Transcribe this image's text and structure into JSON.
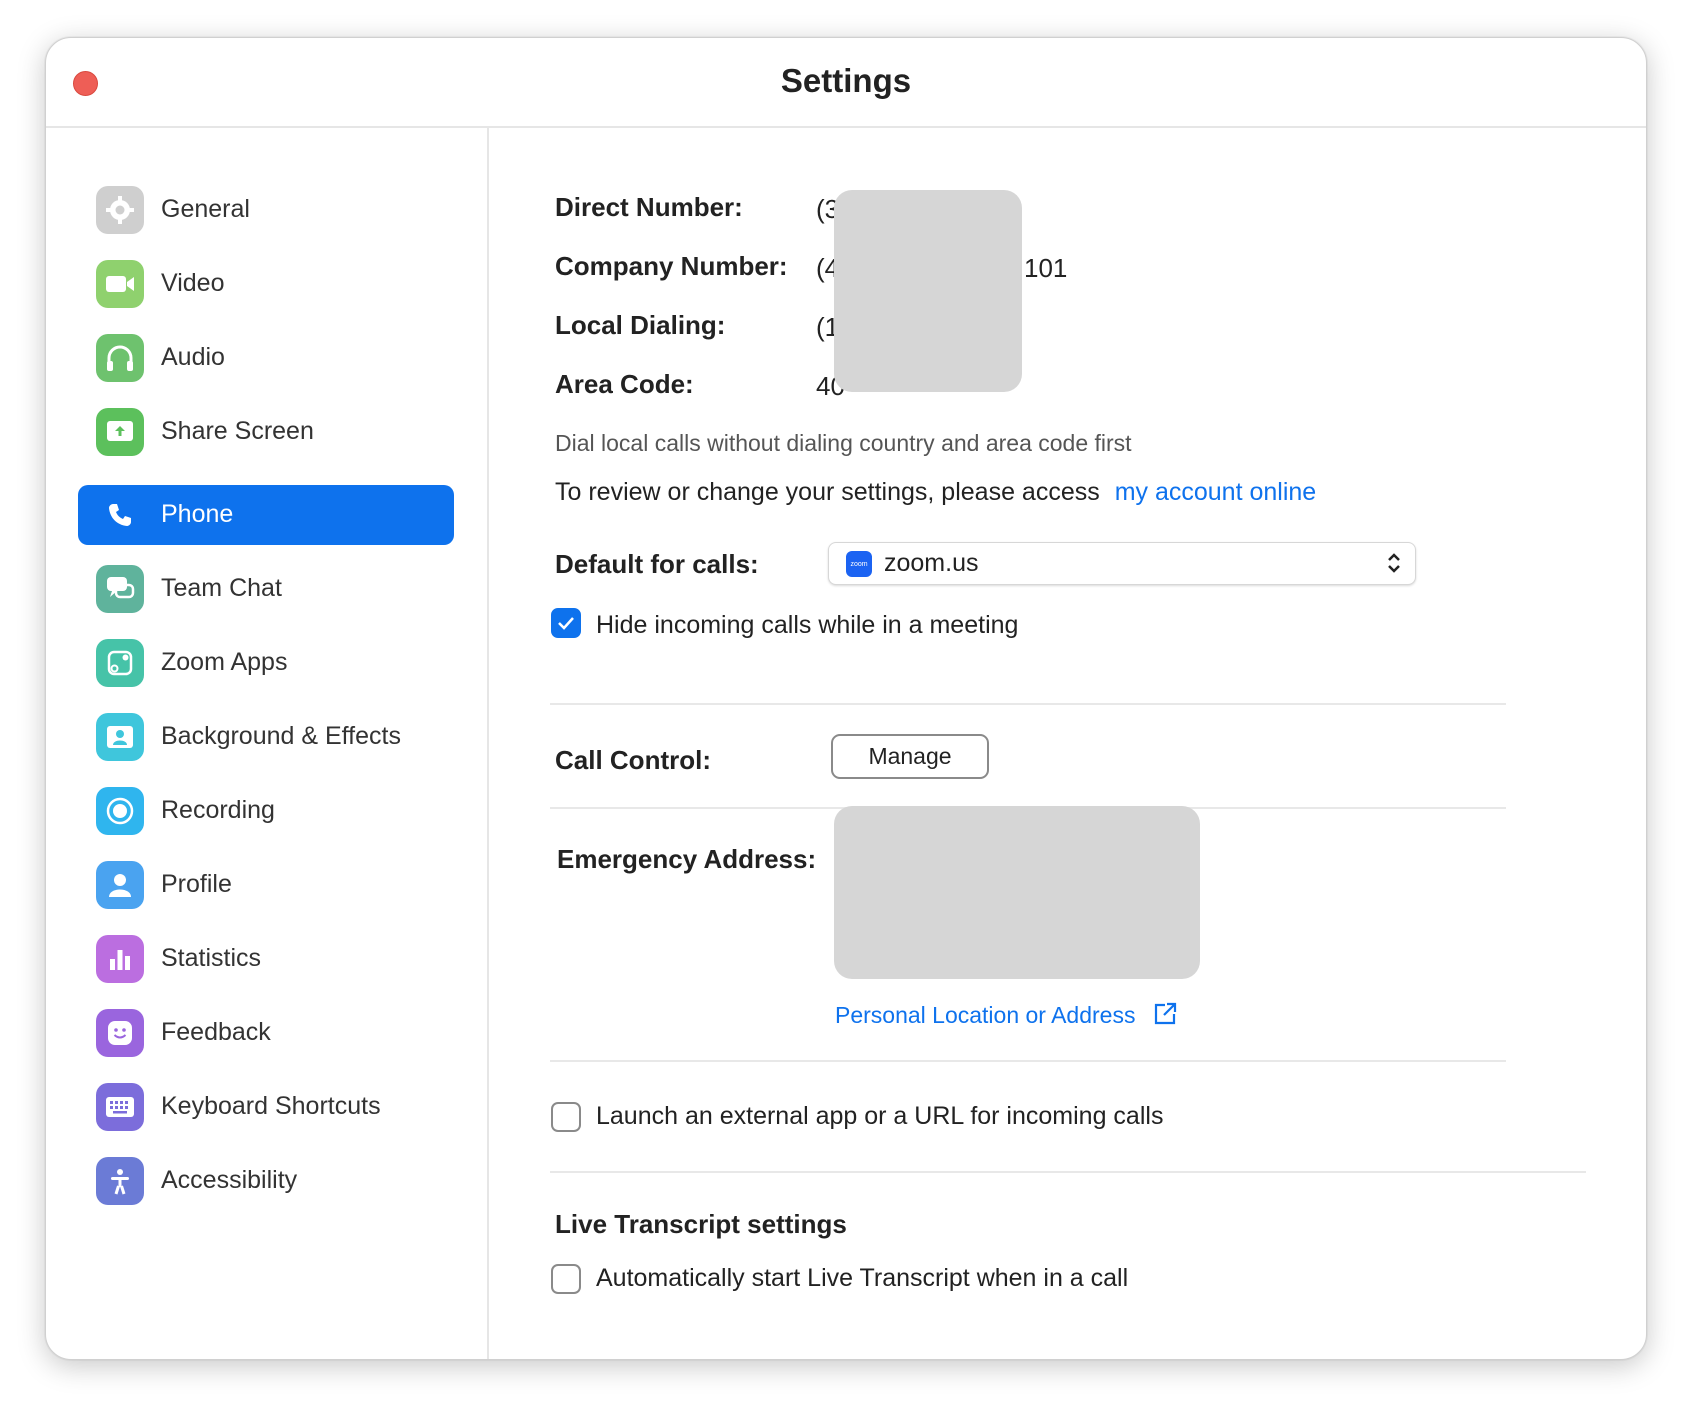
{
  "window": {
    "title": "Settings"
  },
  "sidebar": {
    "items": [
      {
        "label": "General",
        "icon": "gear-icon",
        "color": "#c8c8c8"
      },
      {
        "label": "Video",
        "icon": "video-camera-icon",
        "color": "#8fd16e"
      },
      {
        "label": "Audio",
        "icon": "headphones-icon",
        "color": "#6ec26e"
      },
      {
        "label": "Share Screen",
        "icon": "share-screen-icon",
        "color": "#5cc05c"
      },
      {
        "label": "Phone",
        "icon": "phone-icon",
        "color": "#0e72ed",
        "active": true
      },
      {
        "label": "Team Chat",
        "icon": "chat-icon",
        "color": "#5fb39c"
      },
      {
        "label": "Zoom Apps",
        "icon": "apps-icon",
        "color": "#46c3a8"
      },
      {
        "label": "Background & Effects",
        "icon": "background-person-icon",
        "color": "#3fc6dc"
      },
      {
        "label": "Recording",
        "icon": "record-icon",
        "color": "#2fb5ee"
      },
      {
        "label": "Profile",
        "icon": "person-icon",
        "color": "#4aa3f0"
      },
      {
        "label": "Statistics",
        "icon": "bar-chart-icon",
        "color": "#bb6ee0"
      },
      {
        "label": "Feedback",
        "icon": "smiley-icon",
        "color": "#9a65de"
      },
      {
        "label": "Keyboard Shortcuts",
        "icon": "keyboard-icon",
        "color": "#7c6ddb"
      },
      {
        "label": "Accessibility",
        "icon": "accessibility-icon",
        "color": "#6b7bd6"
      }
    ]
  },
  "phone": {
    "direct_number_label": "Direct Number:",
    "direct_number_value": "(3",
    "company_number_label": "Company Number:",
    "company_number_value": "(4",
    "company_number_suffix": "101",
    "local_dialing_label": "Local Dialing:",
    "local_dialing_value": "(1",
    "area_code_label": "Area Code:",
    "area_code_value": "40",
    "local_dialing_desc": "Dial local calls without dialing country and area code first",
    "review_text": "To review or change your settings, please access",
    "review_link": "my account online",
    "default_calls_label": "Default for calls:",
    "default_calls_value": "zoom.us",
    "zoom_logo_text": "zoom",
    "hide_incoming_label": "Hide incoming calls while in a meeting",
    "hide_incoming_checked": true,
    "call_control_label": "Call Control:",
    "manage_button": "Manage",
    "emergency_label": "Emergency Address:",
    "personal_location_link": "Personal Location or Address",
    "launch_external_label": "Launch an external app or a URL for incoming calls",
    "launch_external_checked": false,
    "live_transcript_heading": "Live Transcript settings",
    "auto_transcript_label": "Automatically start Live Transcript when in a call",
    "auto_transcript_checked": false
  },
  "colors": {
    "accent": "#0e72ed",
    "close": "#ee5e56",
    "redaction": "#d6d6d6"
  }
}
